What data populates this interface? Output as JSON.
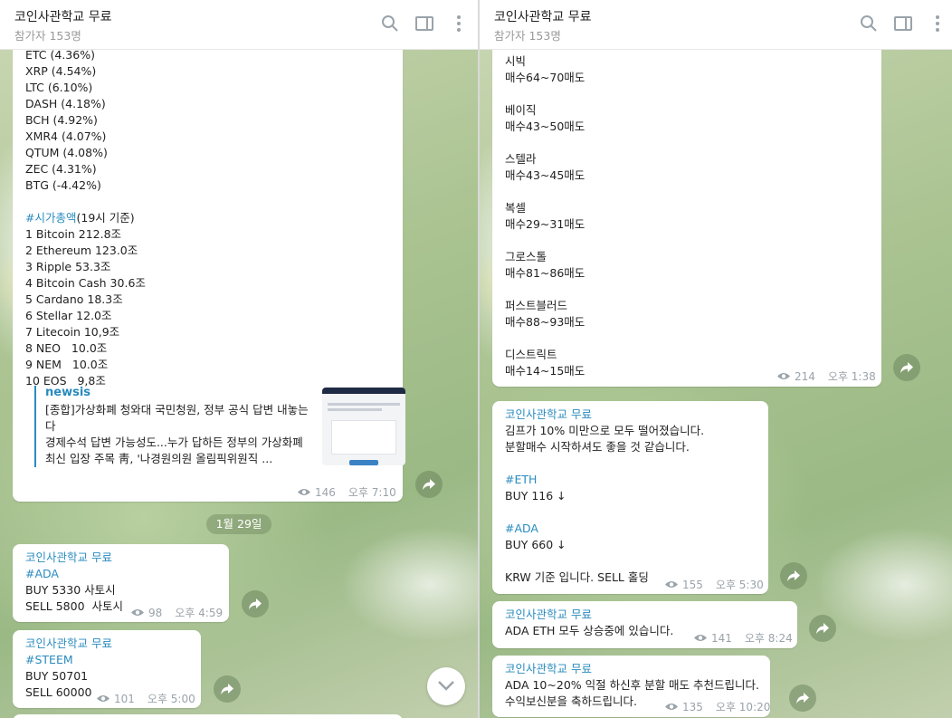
{
  "channel": {
    "title": "코인사관학교 무료",
    "subtitle": "참가자 153명"
  },
  "icons": {
    "search": "search-icon",
    "sidebar": "sidebar-panel-icon",
    "more": "more-vertical-icon",
    "views": "eye-icon",
    "forward": "forward-arrow-icon",
    "scroll": "chevron-down-icon"
  },
  "colors": {
    "accent": "#2a8bbf",
    "meta": "#9aa3aa"
  },
  "left": {
    "msg1": {
      "lines": [
        "ETC (4.36%)",
        "XRP (4.54%)",
        "LTC (6.10%)",
        "DASH (4.18%)",
        "BCH (4.92%)",
        "XMR4 (4.07%)",
        "QTUM (4.08%)",
        "ZEC (4.31%)",
        "BTG (-4.42%)"
      ],
      "cap_hashtag": "#시가총액",
      "cap_suffix": "(19시 기준)",
      "caps": [
        "1 Bitcoin 212.8조",
        "2 Ethereum 123.0조",
        "3 Ripple 53.3조",
        "4 Bitcoin Cash 30.6조",
        "5 Cardano 18.3조",
        "6 Stellar 12.0조",
        "7 Litecoin 10,9조",
        "8 NEO   10.0조",
        "9 NEM   10.0조",
        "10 EOS   9,8조"
      ],
      "preview": {
        "site": "newsis",
        "title": "[종합]가상화폐 청와대 국민청원, 정부 공식 답변 내놓는다",
        "desc": "경제수석 답변 가능성도...누가 답하든 정부의 가상화폐 최신 입장 주목 靑, '나경원의원 올림픽위원직 ..."
      },
      "views": "146",
      "time": "오후 7:10"
    },
    "date": "1월 29일",
    "msg2": {
      "sender": "코인사관학교 무료",
      "hashtag": "#ADA",
      "lines": [
        "BUY 5330 사토시",
        "SELL 5800  사토시"
      ],
      "views": "98",
      "time": "오후 4:59"
    },
    "msg3": {
      "sender": "코인사관학교 무료",
      "hashtag": "#STEEM",
      "lines": [
        "BUY 50701",
        "SELL 60000"
      ],
      "views": "101",
      "time": "오후 5:00"
    }
  },
  "right": {
    "msg1": {
      "lines": [
        "시빅",
        "매수64~70매도",
        "",
        "베이직",
        "매수43~50매도",
        "",
        "스텔라",
        "매수43~45매도",
        "",
        "복셀",
        "매수29~31매도",
        "",
        "그로스톨",
        "매수81~86매도",
        "",
        "퍼스트블러드",
        "매수88~93매도",
        "",
        "디스트릭트",
        "매수14~15매도"
      ],
      "views": "214",
      "time": "오후 1:38"
    },
    "msg2": {
      "sender": "코인사관학교 무료",
      "line1": "김프가 10% 미만으로 모두 떨어졌습니다.",
      "line2": "분할매수 시작하셔도 좋을 것 같습니다.",
      "hashtag1": "#ETH",
      "buy1": "BUY 116 ↓",
      "hashtag2": "#ADA",
      "buy2": "BUY 660 ↓",
      "note": "KRW 기준 입니다. SELL 홀딩",
      "views": "155",
      "time": "오후 5:30"
    },
    "msg3": {
      "sender": "코인사관학교 무료",
      "text": "ADA ETH 모두 상승중에 있습니다.",
      "views": "141",
      "time": "오후 8:24"
    },
    "msg4": {
      "sender": "코인사관학교 무료",
      "line1": "ADA 10~20% 익절 하신후 분할 매도 추천드립니다.",
      "line2": "수익보신분을 축하드립니다.",
      "views": "135",
      "time": "오후 10:20"
    }
  }
}
